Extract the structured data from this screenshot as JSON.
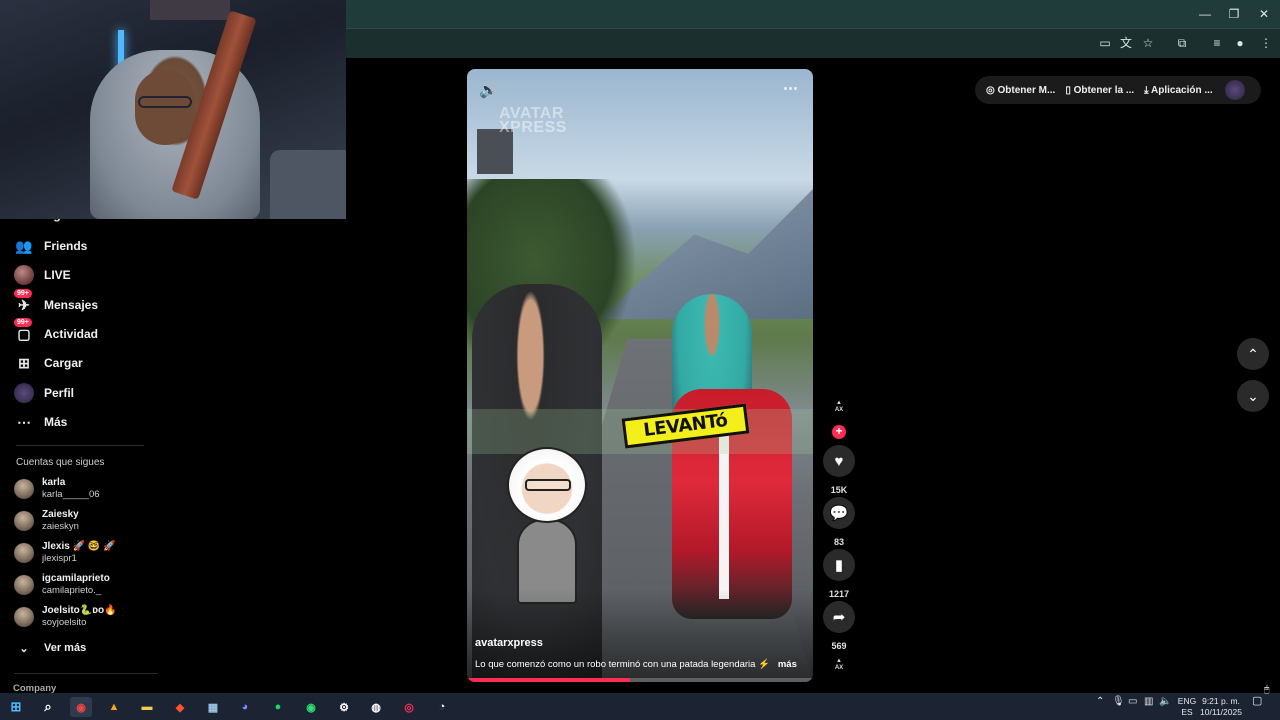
{
  "window": {
    "controls": {
      "minimize": "—",
      "restore": "❐",
      "close": "✕"
    }
  },
  "toolbar_icons": [
    "cast-icon",
    "translate-icon",
    "star-icon",
    "extensions-icon",
    "media-icon",
    "profile-icon",
    "menu-icon"
  ],
  "sidebar": {
    "partial_item": "Siguiendo",
    "items": [
      {
        "label": "Friends",
        "icon": "friends-icon"
      },
      {
        "label": "LIVE",
        "icon": "live-avatar"
      },
      {
        "label": "Mensajes",
        "icon": "messages-icon",
        "badge": "99+"
      },
      {
        "label": "Actividad",
        "icon": "activity-icon",
        "badge": "99+"
      },
      {
        "label": "Cargar",
        "icon": "upload-icon"
      },
      {
        "label": "Perfil",
        "icon": "profile-avatar"
      },
      {
        "label": "Más",
        "icon": "more-icon"
      }
    ],
    "following_title": "Cuentas que sigues",
    "accounts": [
      {
        "name": "karla",
        "handle": "karla_____06"
      },
      {
        "name": "Zaiesky",
        "handle": "zaieskyn"
      },
      {
        "name": "Jlexis 🚀 🤓 🚀",
        "handle": "jlexispr1"
      },
      {
        "name": "igcamilaprieto",
        "handle": "camilaprieto._"
      },
      {
        "name": "Joelsito🐍ᴅᴏ🔥",
        "handle": "soyjoelsito"
      }
    ],
    "see_more": "Ver más",
    "company": "Company"
  },
  "video": {
    "watermark_line1": "AVATAR",
    "watermark_line2": "XPRESS",
    "overlay_word": "LEVANTó",
    "author": "avatarxpress",
    "description": "Lo que comenzó como un robo terminó con una patada legendaria ⚡",
    "more": "más",
    "progress": 0.47
  },
  "actions": {
    "likes": "15K",
    "comments": "83",
    "saves": "1217",
    "shares": "569"
  },
  "topbar": {
    "get_coins": "Obtener M...",
    "get_app": "Obtener la ...",
    "desktop_app": "Aplicación ..."
  },
  "taskbar": {
    "lang": "ENG",
    "region": "ES",
    "time": "9:21 p. m.",
    "date": "10/11/2025"
  },
  "colors": {
    "accent": "#fe2c55",
    "chrome": "#1f3b3a",
    "taskbar": "#1c2433"
  }
}
